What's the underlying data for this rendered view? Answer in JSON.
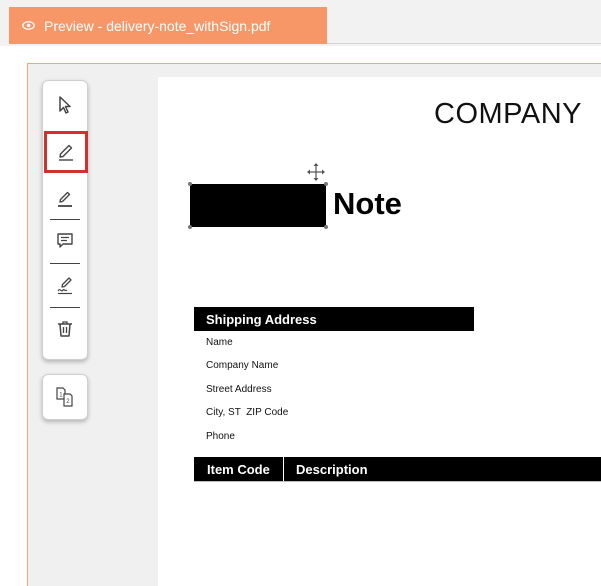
{
  "tab": {
    "icon": "eye-icon",
    "title": "Preview - delivery-note_withSign.pdf",
    "color": "#f79768"
  },
  "toolbar": {
    "tools": [
      {
        "name": "select-tool",
        "icon": "cursor-arrow-icon"
      },
      {
        "name": "draw-tool",
        "icon": "pen-icon",
        "active": true
      },
      {
        "name": "highlight-tool",
        "icon": "pen-underline-icon"
      },
      {
        "name": "comment-tool",
        "icon": "comment-icon"
      },
      {
        "name": "signature-tool",
        "icon": "signature-icon"
      },
      {
        "name": "delete-tool",
        "icon": "trash-icon"
      }
    ],
    "page_organize_icon": "page-numbers-icon",
    "active_color": "#d32f2f"
  },
  "document": {
    "company": "COMPANY",
    "title_suffix": "Note",
    "shipping": {
      "header": "Shipping Address",
      "lines": [
        "Name",
        "Company Name",
        "Street Address",
        "City, ST  ZIP Code",
        "Phone"
      ]
    },
    "items": {
      "columns": [
        "Item Code",
        "Description"
      ]
    }
  }
}
